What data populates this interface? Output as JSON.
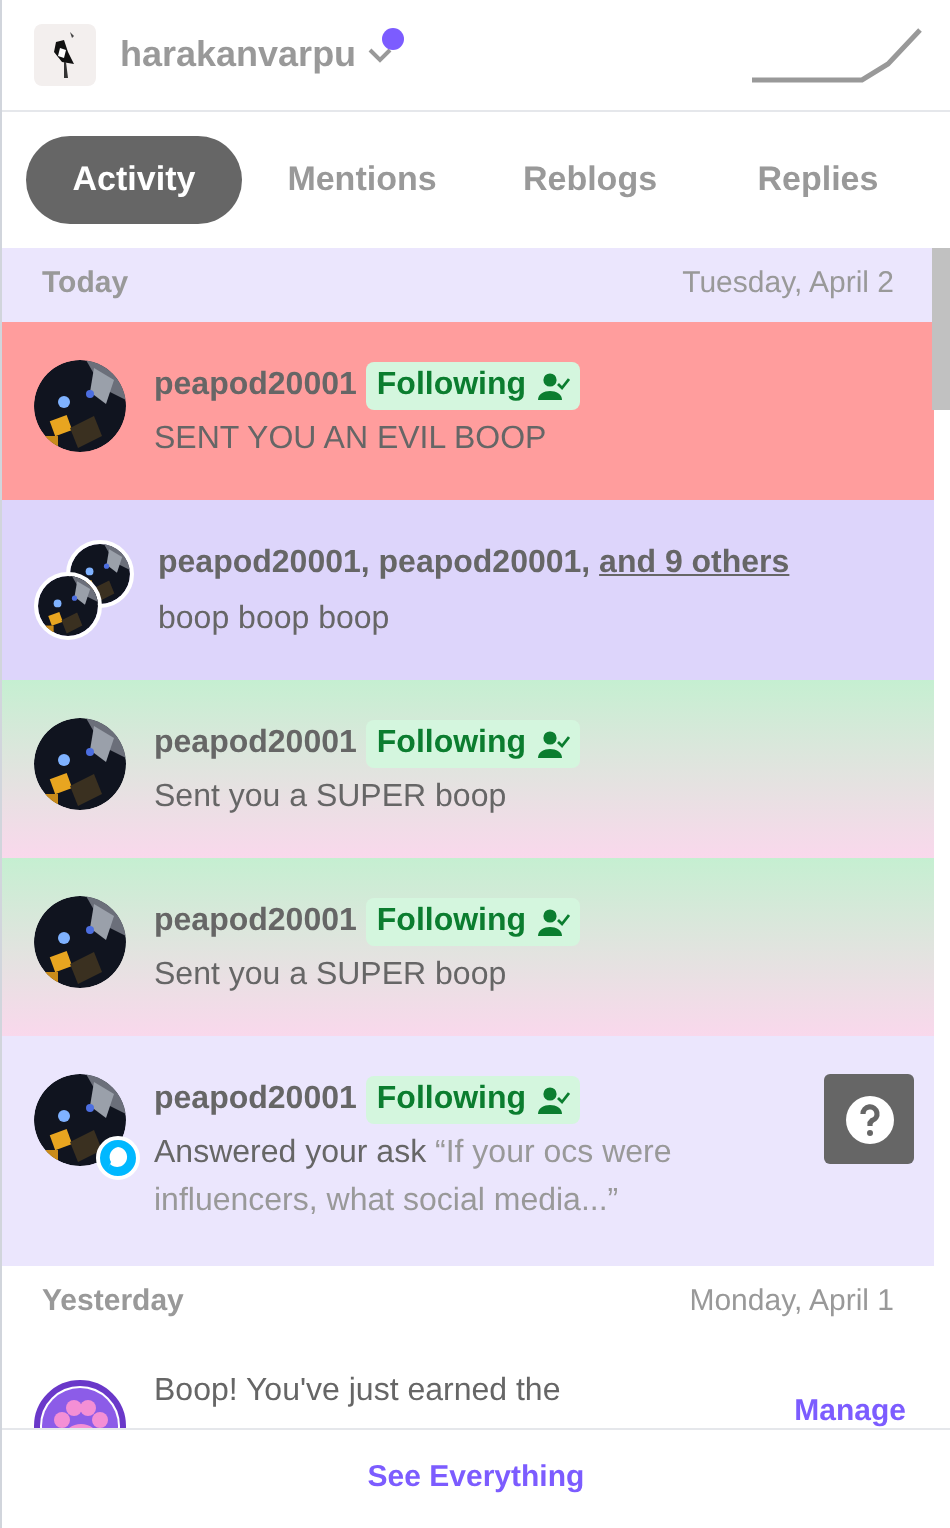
{
  "header": {
    "username": "harakanvarpu",
    "unread": true
  },
  "tabs": [
    {
      "label": "Activity",
      "selected": true
    },
    {
      "label": "Mentions",
      "selected": false
    },
    {
      "label": "Reblogs",
      "selected": false
    },
    {
      "label": "Replies",
      "selected": false
    }
  ],
  "sections": [
    {
      "label": "Today",
      "date": "Tuesday, April 2",
      "items": [
        {
          "kind": "evil",
          "name": "peapod20001",
          "following": "Following",
          "text": "SENT YOU AN EVIL BOOP"
        },
        {
          "kind": "group",
          "names": "peapod20001, peapod20001,",
          "others_link": "and 9 others",
          "text": "boop boop boop"
        },
        {
          "kind": "super",
          "name": "peapod20001",
          "following": "Following",
          "text": "Sent you a SUPER boop"
        },
        {
          "kind": "super",
          "name": "peapod20001",
          "following": "Following",
          "text": "Sent you a SUPER boop"
        },
        {
          "kind": "ask",
          "name": "peapod20001",
          "following": "Following",
          "action": "Answered your ask",
          "quote": "“If your ocs were influencers, what social media...”"
        }
      ]
    },
    {
      "label": "Yesterday",
      "date": "Monday, April 1",
      "items": [
        {
          "kind": "badge",
          "text": "Boop! You've just earned the",
          "action_link": "Manage"
        }
      ]
    }
  ],
  "footer": {
    "link": "See Everything"
  }
}
